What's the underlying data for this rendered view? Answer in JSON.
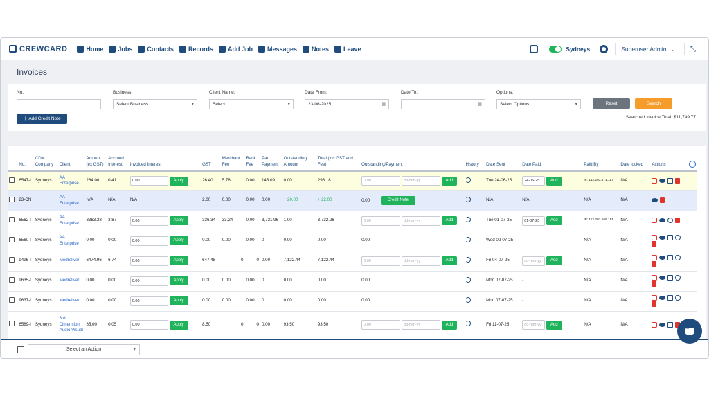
{
  "brand": {
    "name": "CREWCARD"
  },
  "nav": [
    {
      "label": "Home",
      "icon": "home-icon"
    },
    {
      "label": "Jobs",
      "icon": "list-icon"
    },
    {
      "label": "Contacts",
      "icon": "contact-icon"
    },
    {
      "label": "Records",
      "icon": "records-icon"
    },
    {
      "label": "Add Job",
      "icon": "plus-square-icon"
    },
    {
      "label": "Messages",
      "icon": "chat-icon"
    },
    {
      "label": "Notes",
      "icon": "note-icon"
    },
    {
      "label": "Leave",
      "icon": "calendar-x-icon"
    }
  ],
  "header_right": {
    "location": "Sydneys",
    "user": "Superuser Admin"
  },
  "page_title": "Invoices",
  "filters": {
    "no_label": "No.",
    "no_value": "",
    "business_label": "Business:",
    "business_value": "Select Business",
    "client_label": "Client Name:",
    "client_value": "Select",
    "date_from_label": "Date From:",
    "date_from_value": "23-06-2025",
    "date_to_label": "Date To:",
    "date_to_value": "",
    "options_label": "Options:",
    "options_value": "Select Options",
    "reset": "Reset",
    "search": "Search",
    "add_credit_note": "Add Credit Note",
    "total_text": "Searched Invoice Total: $11,749.77"
  },
  "table": {
    "headers": {
      "no": "No.",
      "cdx": "CDX Company",
      "client": "Client",
      "amount": "Amount (ex GST)",
      "accrued": "Accrued Interest",
      "invoiced": "Invoiced Interest",
      "gst": "GST",
      "merchant": "Merchant Fee",
      "bank": "Bank Fee",
      "part": "Part Payment",
      "outstanding": "Outstanding Amount",
      "total": "Total (inc GST and Fee)",
      "outpay": "Outstanding/Payment",
      "history": "History",
      "date_sent": "Date Sent",
      "date_paid": "Date Paid",
      "paid_by": "Paid By",
      "date_locked": "Date locked",
      "actions": "Actions"
    },
    "placeholders": {
      "amount": "0.00",
      "date": "dd-mm-yy"
    },
    "buttons": {
      "apply": "Apply",
      "add": "Add",
      "credit_note": "Credit Note"
    },
    "rows": [
      {
        "no": "6547-I",
        "cdx": "Sydneys",
        "client": "AA Enterprise",
        "amount": "264.00",
        "accrued": "0.41",
        "invoiced": "0.00",
        "gst": "26.40",
        "merchant": "5.78",
        "bank": "0.00",
        "part": "148.09",
        "outstanding": "0.00",
        "total": "296.18",
        "date_sent": "Tue 24-06-25",
        "date_paid": "24-06-25",
        "paid_by": "IP: 112.203.171.117",
        "date_locked": "N/A"
      },
      {
        "no": "23-CN",
        "cdx": "",
        "client": "AA Enterprise",
        "amount": "N/A",
        "accrued": "N/A",
        "invoiced": "N/A",
        "gst": "2.00",
        "merchant": "0.00",
        "bank": "0.00",
        "part": "0.00",
        "outstanding": "+ 20.00",
        "total": "+ 22.00",
        "out_value": "0.00",
        "date_sent": "N/A",
        "date_paid": "N/A",
        "paid_by": "N/A",
        "date_locked": "N/A"
      },
      {
        "no": "6562-I",
        "cdx": "Sydneys",
        "client": "AA Enterprise",
        "amount": "3363.38",
        "accrued": "3.87",
        "invoiced": "0.00",
        "gst": "336.34",
        "merchant": "33.24",
        "bank": "0.00",
        "part": "3,731.96",
        "outstanding": "1.00",
        "total": "3,732.96",
        "date_sent": "Tue 01-07-25",
        "date_paid": "01-07-25",
        "paid_by": "IP: 112.203.169.181",
        "date_locked": "N/A"
      },
      {
        "no": "6560-I",
        "cdx": "Sydneys",
        "client": "AA Enterprise",
        "amount": "0.00",
        "accrued": "0.00",
        "invoiced": "0.00",
        "gst": "0.00",
        "merchant": "0.00",
        "bank": "0.00",
        "part": "0",
        "outstanding": "0.00",
        "total": "0.00",
        "out_value": "0.00",
        "date_sent": "Wed 02-07-25",
        "date_paid": "-",
        "paid_by": "N/A",
        "date_locked": "N/A"
      },
      {
        "no": "9496-I",
        "cdx": "Sydneys",
        "client": "Medreliver",
        "amount": "6474.96",
        "accrued": "6.74",
        "invoiced": "0.00",
        "gst": "647.48",
        "merchant": "0",
        "bank": "0",
        "part": "0.00",
        "outstanding": "7,122.44",
        "total": "7,122.44",
        "date_sent": "Fri 04-07-25",
        "date_paid": "",
        "paid_by": "N/A",
        "date_locked": "N/A"
      },
      {
        "no": "9635-I",
        "cdx": "Sydneys",
        "client": "Medreliver",
        "amount": "0.00",
        "accrued": "0.00",
        "invoiced": "0.00",
        "gst": "0.00",
        "merchant": "0.00",
        "bank": "0.00",
        "part": "0",
        "outstanding": "0.00",
        "total": "0.00",
        "out_value": "0.00",
        "date_sent": "Mon 07-07-25",
        "date_paid": "-",
        "paid_by": "N/A",
        "date_locked": "N/A"
      },
      {
        "no": "9637-I",
        "cdx": "Sydneys",
        "client": "Medreliver",
        "amount": "0.00",
        "accrued": "0.00",
        "invoiced": "0.00",
        "gst": "0.00",
        "merchant": "0.00",
        "bank": "0.00",
        "part": "0",
        "outstanding": "0.00",
        "total": "0.00",
        "out_value": "0.00",
        "date_sent": "Mon 07-07-25",
        "date_paid": "-",
        "paid_by": "N/A",
        "date_locked": "N/A"
      },
      {
        "no": "6589-I",
        "cdx": "Sydneys",
        "client": "3rd Dimension Audio Visual",
        "amount": "85.00",
        "accrued": "0.05",
        "invoiced": "0.00",
        "gst": "8.50",
        "merchant": "0",
        "bank": "0",
        "part": "0.00",
        "outstanding": "93.50",
        "total": "93.50",
        "date_sent": "Fri 11-07-25",
        "date_paid": "",
        "paid_by": "N/A",
        "date_locked": "N/A"
      }
    ]
  },
  "bottom": {
    "action_select": "Select an Action"
  },
  "colors": {
    "primary": "#1f4b7d",
    "green": "#1fb35b",
    "orange": "#f59c2b",
    "red": "#e0342c"
  }
}
